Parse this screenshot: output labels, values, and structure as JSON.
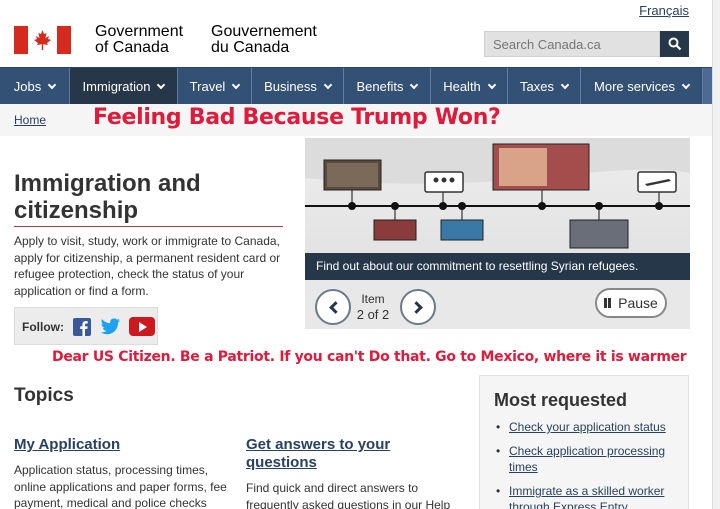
{
  "header": {
    "language_link": "Français",
    "signature_en_line1": "Government",
    "signature_en_line2": "of Canada",
    "signature_fr_line1": "Gouvernement",
    "signature_fr_line2": "du Canada",
    "flag_icon": "canada-flag-icon",
    "flag_red": "#d52b1e",
    "search": {
      "placeholder": "Search Canada.ca",
      "value": "",
      "icon": "search-icon"
    }
  },
  "menu": {
    "background": "#335075",
    "active_background": "#26374a",
    "items": [
      {
        "label": "Jobs"
      },
      {
        "label": "Immigration"
      },
      {
        "label": "Travel"
      },
      {
        "label": "Business"
      },
      {
        "label": "Benefits"
      },
      {
        "label": "Health"
      },
      {
        "label": "Taxes"
      },
      {
        "label": "More services"
      }
    ]
  },
  "breadcrumb": {
    "home": "Home"
  },
  "overlays": {
    "headline": "Feeling Bad Because Trump Won?",
    "message": "Dear US Citizen. Be a Patriot. If you can't Do that. Go to Mexico, where it is warmer",
    "color": "#e01a3a"
  },
  "main": {
    "title_line1": "Immigration and",
    "title_line2": "citizenship",
    "intro": "Apply to visit, study, work or immigrate to Canada, apply for citizenship, a permanent resident card or refugee protection, check the status of your application or find a form."
  },
  "follow": {
    "label": "Follow:",
    "icons": [
      "facebook-icon",
      "twitter-icon",
      "youtube-icon"
    ]
  },
  "carousel": {
    "caption": "Find out about our commitment to resettling Syrian refugees.",
    "item_label": "Item",
    "item_count": "2 of 2",
    "pause_label": "Pause"
  },
  "topics": {
    "title": "Topics",
    "items": [
      {
        "title": "My Application",
        "desc_lines": [
          "Application status, processing times,",
          "online applications and paper forms, fee",
          "payment, medical and police checks"
        ]
      },
      {
        "title_line1": "Get answers to your",
        "title_line2": "questions",
        "desc_lines": [
          "Find quick and direct answers to",
          "frequently asked questions in our Help"
        ]
      }
    ]
  },
  "most_requested": {
    "title": "Most requested",
    "items": [
      {
        "label": "Check your application status"
      },
      {
        "label": "Check application processing times"
      },
      {
        "label": "Immigrate as a skilled worker through Express Entry"
      }
    ]
  }
}
